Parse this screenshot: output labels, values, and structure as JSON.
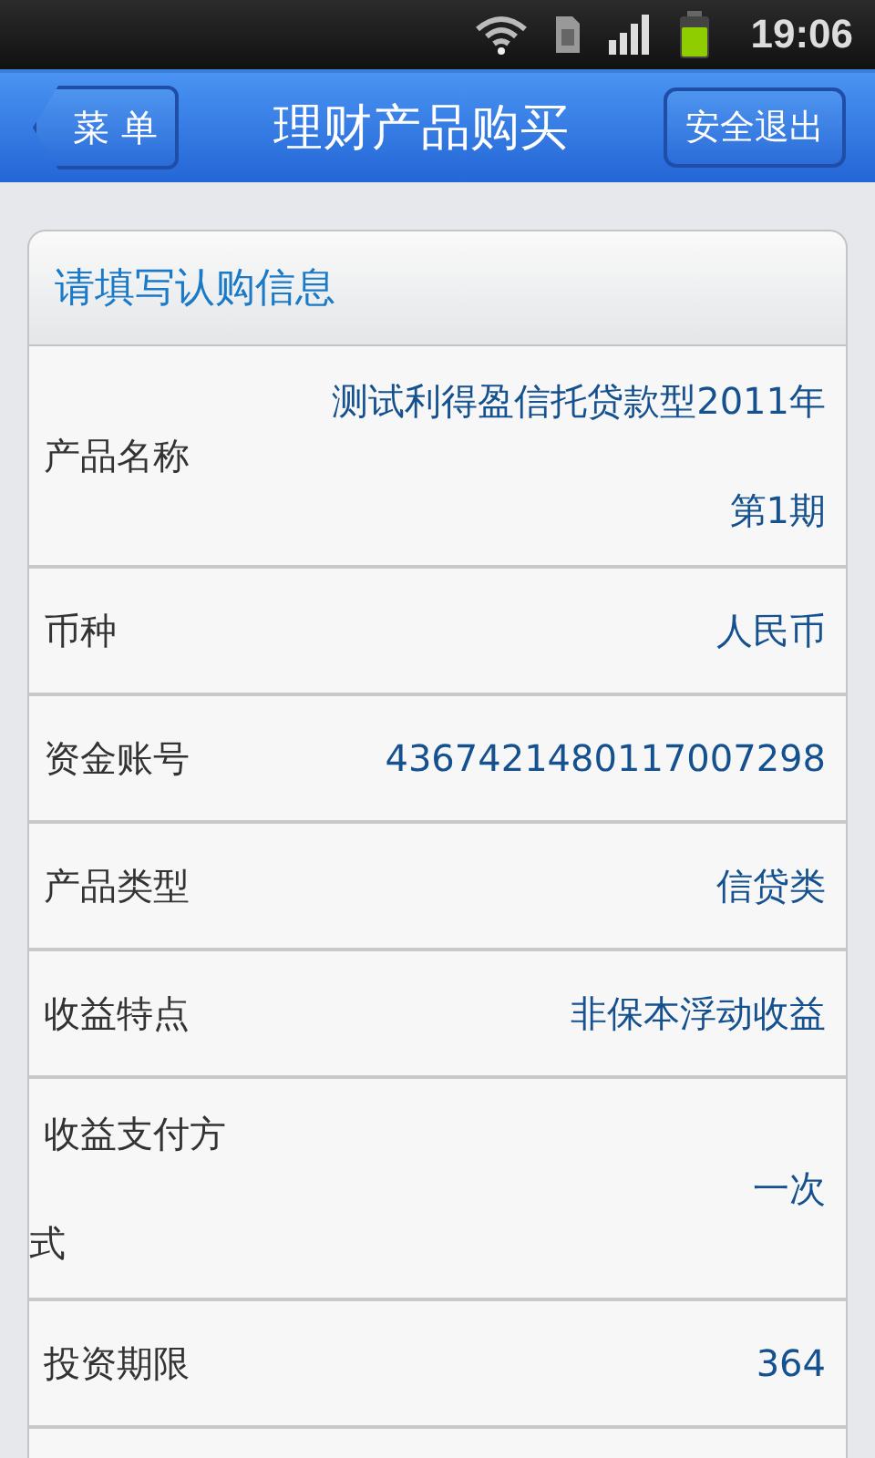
{
  "status_bar": {
    "time": "19:06"
  },
  "header": {
    "back_button": "菜 单",
    "title": "理财产品购买",
    "logout_button": "安全退出"
  },
  "form": {
    "title": "请填写认购信息",
    "rows": [
      {
        "label": "产品名称",
        "value": "测试利得盈信托贷款型2011年第1期"
      },
      {
        "label": "币种",
        "value": "人民币"
      },
      {
        "label": "资金账号",
        "value": "4367421480117007298"
      },
      {
        "label": "产品类型",
        "value": "信贷类"
      },
      {
        "label": "收益特点",
        "value": "非保本浮动收益"
      },
      {
        "label": "收益支付方式",
        "value": "一次"
      },
      {
        "label": "投资期限",
        "value": "364"
      }
    ]
  }
}
